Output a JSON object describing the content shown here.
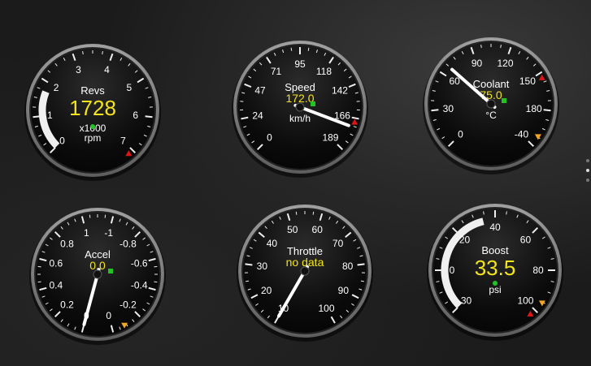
{
  "colors": {
    "value_text": "#f4e41c",
    "label_text": "#ffffff",
    "bezel": "#c9c9c9",
    "face": "#0d0d0d",
    "needle": "#ffffff",
    "warning_marker": "#e01414",
    "min_marker": "#f5a623",
    "indicator": "#22c322",
    "arc": "#f0f0f0"
  },
  "gauges": [
    {
      "id": "revs",
      "title": "Revs",
      "value_text": "1728",
      "unit": "x1000\nrpm",
      "ticks": [
        "0",
        "1",
        "2",
        "3",
        "4",
        "5",
        "6",
        "7"
      ],
      "start_angle": 180,
      "sweep": 270,
      "value_fraction": 0.247,
      "has_needle": false,
      "has_arc": true,
      "warning_tick_index": 7,
      "min_marker": false,
      "indicator_icon": "green-dot-icon"
    },
    {
      "id": "speed",
      "title": "Speed",
      "value_text": "172.0",
      "unit": "km/h",
      "ticks": [
        "0",
        "24",
        "47",
        "71",
        "95",
        "118",
        "142",
        "166",
        "189"
      ],
      "start_angle": 180,
      "sweep": 270,
      "value_fraction": 0.91,
      "has_needle": true,
      "has_arc": false,
      "warning_tick_index": 7,
      "min_marker": false,
      "indicator_icon": "green-square-icon"
    },
    {
      "id": "coolant",
      "title": "Coolant",
      "value_text": "75.0",
      "unit": "°C",
      "ticks": [
        "0",
        "30",
        "60",
        "90",
        "120",
        "150",
        "180",
        "-40"
      ],
      "start_angle": 180,
      "sweep": 270,
      "value_fraction": 0.32,
      "has_needle": true,
      "has_arc": false,
      "warning_tick_index": 5,
      "min_marker": true,
      "indicator_icon": "green-square-icon"
    },
    {
      "id": "accel",
      "title": "Accel",
      "value_text": "0.0",
      "unit": "",
      "ticks": [
        "0",
        "0.2",
        "0.4",
        "0.6",
        "0.8",
        "1",
        "-1",
        "-0.8",
        "-0.6",
        "-0.4",
        "-0.2",
        "0"
      ],
      "start_angle": 180,
      "sweep": 330,
      "value_fraction": 0.0,
      "has_needle": true,
      "has_arc": false,
      "warning_tick_index": -1,
      "min_marker": true,
      "indicator_icon": "green-square-icon"
    },
    {
      "id": "throttle",
      "title": "Throttle",
      "value_text": "no data",
      "unit": "",
      "ticks": [
        "10",
        "20",
        "30",
        "40",
        "50",
        "60",
        "70",
        "80",
        "90",
        "100"
      ],
      "start_angle": 210,
      "sweep": 300,
      "value_fraction": 0.0,
      "has_needle": true,
      "has_arc": false,
      "warning_tick_index": -1,
      "min_marker": false,
      "indicator_icon": ""
    },
    {
      "id": "boost",
      "title": "Boost",
      "value_text": "33.5",
      "unit": "psi",
      "ticks": [
        "-30",
        "0",
        "20",
        "40",
        "60",
        "80",
        "100"
      ],
      "start_angle": 180,
      "sweep": 270,
      "value_fraction": 0.45,
      "has_needle": false,
      "has_arc": true,
      "warning_tick_index": 6,
      "min_marker": true,
      "indicator_icon": "green-dot-icon"
    }
  ]
}
